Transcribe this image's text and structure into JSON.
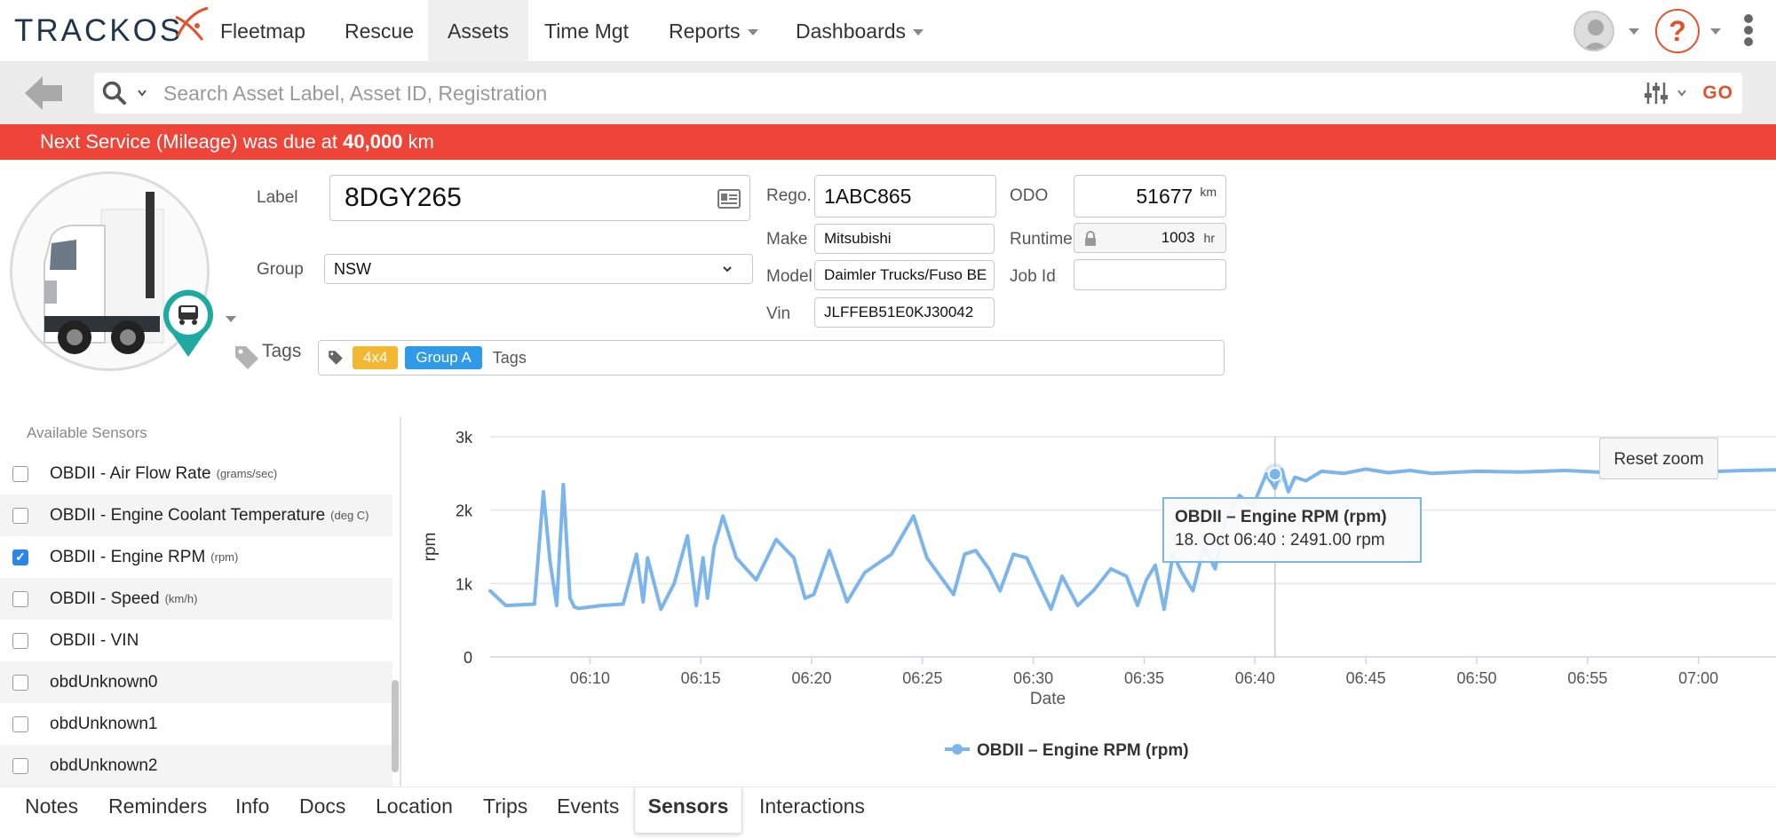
{
  "brand": {
    "logo_text": "TRACKOS"
  },
  "nav": {
    "items": [
      {
        "label": "Fleetmap"
      },
      {
        "label": "Rescue"
      },
      {
        "label": "Assets",
        "active": true
      },
      {
        "label": "Time Mgt"
      },
      {
        "label": "Reports",
        "dropdown": true
      },
      {
        "label": "Dashboards",
        "dropdown": true
      }
    ],
    "help_glyph": "?"
  },
  "search": {
    "placeholder": "Search Asset Label, Asset ID, Registration",
    "value": "",
    "go_label": "GO"
  },
  "alert": {
    "prefix": "Next Service (Mileage) was due at ",
    "value": "40,000",
    "suffix": " km",
    "color": "#ef4438"
  },
  "asset": {
    "label_caption": "Label",
    "label_value": "8DGY265",
    "group_caption": "Group",
    "group_value": "NSW",
    "rego_caption": "Rego.",
    "rego_value": "1ABC865",
    "make_caption": "Make",
    "make_value": "Mitsubishi",
    "model_caption": "Model",
    "model_value": "Daimler Trucks/Fuso BE",
    "vin_caption": "Vin",
    "vin_value": "JLFFEB51E0KJ30042",
    "odo_caption": "ODO",
    "odo_value": "51677",
    "odo_unit": "km",
    "runtime_caption": "Runtime",
    "runtime_value": "1003",
    "runtime_unit": "hr",
    "jobid_caption": "Job Id",
    "jobid_value": "",
    "tags_caption": "Tags",
    "tags": [
      {
        "label": "4x4",
        "color": "#f4b731"
      },
      {
        "label": "Group A",
        "color": "#2f9be8"
      }
    ],
    "tags_placeholder": "Tags"
  },
  "sensors": {
    "heading": "Available Sensors",
    "items": [
      {
        "label": "OBDII - Air Flow Rate",
        "unit": "(grams/sec)",
        "checked": false
      },
      {
        "label": "OBDII - Engine Coolant Temperature",
        "unit": "(deg C)",
        "checked": false
      },
      {
        "label": "OBDII - Engine RPM",
        "unit": "(rpm)",
        "checked": true
      },
      {
        "label": "OBDII - Speed",
        "unit": "(km/h)",
        "checked": false
      },
      {
        "label": "OBDII - VIN",
        "unit": "",
        "checked": false
      },
      {
        "label": "obdUnknown0",
        "unit": "",
        "checked": false
      },
      {
        "label": "obdUnknown1",
        "unit": "",
        "checked": false
      },
      {
        "label": "obdUnknown2",
        "unit": "",
        "checked": false
      }
    ]
  },
  "chart_data": {
    "type": "line",
    "title": "",
    "xlabel": "Date",
    "ylabel": "rpm",
    "x_unit": "minutes past 06:00 (time of day)",
    "xlim": [
      5.5,
      63.5
    ],
    "ylim": [
      0,
      3000
    ],
    "y_ticks": [
      0,
      1000,
      2000,
      3000
    ],
    "y_tick_labels": [
      "0",
      "1k",
      "2k",
      "3k"
    ],
    "x_ticks": [
      10,
      15,
      20,
      25,
      30,
      35,
      40,
      45,
      50,
      55,
      60
    ],
    "x_tick_labels": [
      "06:10",
      "06:15",
      "06:20",
      "06:25",
      "06:30",
      "06:35",
      "06:40",
      "06:45",
      "06:50",
      "06:55",
      "07:00"
    ],
    "grid": true,
    "legend": "bottom-center",
    "series": [
      {
        "name": "OBDII – Engine RPM (rpm)",
        "color": "#7cb5ec",
        "x": [
          5.5,
          6.2,
          7.5,
          7.9,
          8.2,
          8.5,
          8.8,
          9.1,
          9.3,
          9.5,
          10.5,
          11.5,
          12.1,
          12.4,
          12.6,
          13.2,
          13.8,
          14.4,
          14.8,
          15.1,
          15.3,
          15.6,
          16.0,
          16.6,
          17.5,
          18.4,
          19.2,
          19.7,
          20.1,
          20.8,
          21.6,
          22.4,
          23.6,
          24.6,
          25.2,
          25.8,
          26.4,
          26.9,
          27.4,
          28.0,
          28.5,
          29.1,
          29.7,
          30.4,
          30.8,
          31.3,
          32.0,
          32.7,
          33.5,
          34.2,
          34.7,
          35.1,
          35.5,
          35.9,
          36.3,
          36.7,
          37.2,
          37.7,
          38.2,
          38.7,
          39.3,
          39.9,
          40.5,
          40.9,
          41.2,
          41.5,
          41.8,
          42.3,
          43.0,
          44.0,
          45.0,
          46.0,
          47.0,
          48.0,
          50.0,
          52.0,
          54.0,
          56.0,
          58.0,
          60.0,
          62.0,
          63.5
        ],
        "y": [
          900,
          700,
          720,
          2250,
          1300,
          700,
          2350,
          800,
          680,
          660,
          700,
          720,
          1400,
          750,
          1350,
          650,
          1000,
          1650,
          700,
          1350,
          800,
          1500,
          1920,
          1350,
          1050,
          1600,
          1350,
          800,
          850,
          1450,
          750,
          1150,
          1400,
          1920,
          1350,
          1100,
          850,
          1400,
          1450,
          1200,
          900,
          1400,
          1350,
          900,
          650,
          1100,
          700,
          900,
          1200,
          1100,
          700,
          1050,
          1250,
          650,
          1400,
          1150,
          900,
          1500,
          1200,
          1900,
          2200,
          2050,
          2491,
          2300,
          2550,
          2250,
          2450,
          2400,
          2530,
          2500,
          2560,
          2510,
          2540,
          2500,
          2530,
          2520,
          2540,
          2510,
          2530,
          2520,
          2540,
          2550
        ]
      }
    ],
    "tooltip": {
      "title": "OBDII – Engine RPM (rpm)",
      "text": "18. Oct 06:40 : 2491.00 rpm",
      "point": {
        "x": 40.9,
        "y": 2491
      }
    },
    "reset_zoom_label": "Reset zoom"
  },
  "tabs": [
    {
      "label": "Notes"
    },
    {
      "label": "Reminders"
    },
    {
      "label": "Info"
    },
    {
      "label": "Docs"
    },
    {
      "label": "Location"
    },
    {
      "label": "Trips"
    },
    {
      "label": "Events"
    },
    {
      "label": "Sensors",
      "active": true
    },
    {
      "label": "Interactions"
    }
  ]
}
